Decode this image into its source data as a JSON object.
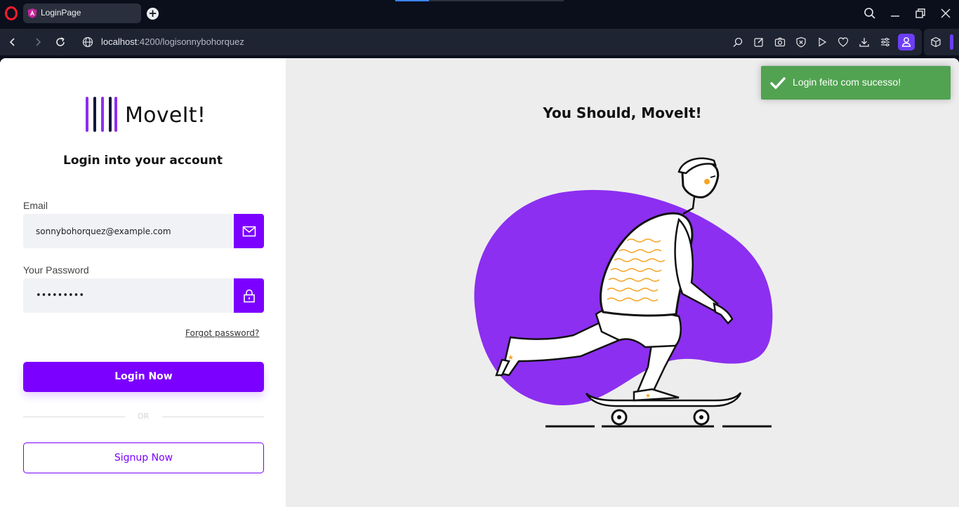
{
  "browser": {
    "tab_title": "LoginPage",
    "url_host": "localhost",
    "url_path": ":4200/logisonnybohorquez"
  },
  "brand": {
    "name": "MoveIt!"
  },
  "login": {
    "heading": "Login into your account",
    "email_label": "Email",
    "email_value": "sonnybohorquez@example.com",
    "password_label": "Your Password",
    "password_value": "•••••••••",
    "forgot_label": "Forgot password?",
    "login_button": "Login Now",
    "or_text": "OR",
    "signup_button": "Signup Now"
  },
  "hero": {
    "title": "You Should, MoveIt!"
  },
  "toast": {
    "message": "Login feito com sucesso!"
  },
  "colors": {
    "accent": "#7b00ff",
    "blob": "#8c2ff0",
    "toast": "#51a351"
  }
}
